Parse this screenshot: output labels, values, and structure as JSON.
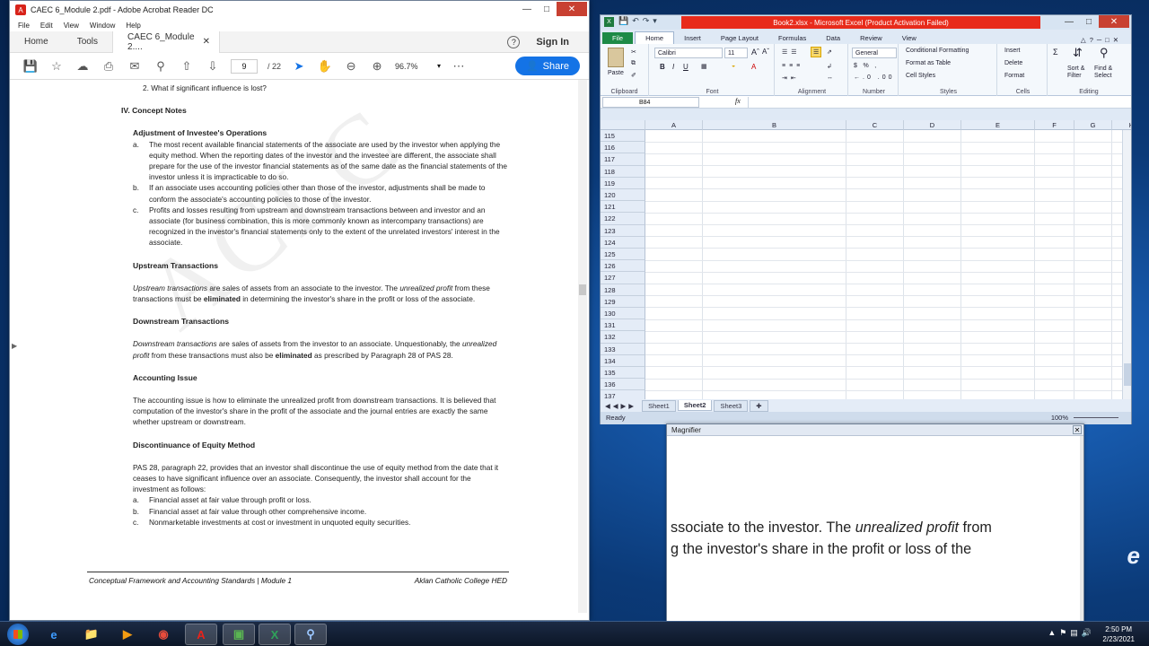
{
  "acrobat": {
    "title": "CAEC 6_Module 2.pdf - Adobe Acrobat Reader DC",
    "menu": [
      "File",
      "Edit",
      "View",
      "Window",
      "Help"
    ],
    "tabs": {
      "home": "Home",
      "tools": "Tools",
      "document": "CAEC 6_Module 2...."
    },
    "signin": "Sign In",
    "help": "?",
    "toolbar": {
      "page_current": "9",
      "page_total": "/ 22",
      "zoom": "96.7%",
      "share": "Share"
    }
  },
  "document": {
    "q2": "2.   What if significant influence is lost?",
    "section": "IV.  Concept Notes",
    "adj_heading": "Adjustment of Investee's Operations",
    "adj_items": [
      {
        "m": "a.",
        "t": "The most recent available financial statements of the associate are used by the investor when applying the equity method. When the reporting dates of the investor and the investee are different, the associate shall prepare for the use of the investor financial statements as of the same date as the financial statements of the investor unless it is impracticable to do so."
      },
      {
        "m": "b.",
        "t": "If an associate uses accounting policies other than those of the investor, adjustments shall be made to conform the associate's accounting policies to those of the investor."
      },
      {
        "m": "c.",
        "t": "Profits and losses resulting from upstream and downstream transactions between and investor and an associate (for business combination, this is more commonly known as intercompany transactions) are recognized in the investor's financial statements only to the extent of the unrelated investors' interest in the associate."
      }
    ],
    "up_heading": "Upstream Transactions",
    "up_a": "Upstream transactions",
    "up_b": " are sales of assets from an associate to the investor. The ",
    "up_c": "unrealized profit",
    "up_d": " from these transactions must be ",
    "up_e": "eliminated",
    "up_f": " in determining the investor's share in the profit or loss of the associate.",
    "down_heading": "Downstream Transactions",
    "down_a": "Downstream transactions",
    "down_b": " are sales of assets from the investor to an associate. Unquestionably, the ",
    "down_c": "unrealized profit",
    "down_d": " from these transactions must also be ",
    "down_e": "eliminated",
    "down_f": " as prescribed by Paragraph 28 of PAS 28.",
    "issue_heading": "Accounting Issue",
    "issue_text": "The accounting issue is how to eliminate the unrealized profit from downstream transactions. It is believed that computation of the investor's share in the profit of the associate and the journal entries are exactly the same whether upstream or downstream.",
    "disc_heading": "Discontinuance of Equity Method",
    "disc_text": "PAS 28, paragraph 22, provides that an investor shall discontinue the use of equity method from the date that it ceases to have significant influence over an associate. Consequently, the investor shall account for the investment as follows:",
    "disc_items": [
      {
        "m": "a.",
        "t": "Financial asset at fair value through profit or loss."
      },
      {
        "m": "b.",
        "t": "Financial asset at fair value through other comprehensive income."
      },
      {
        "m": "c.",
        "t": "Nonmarketable investments at cost or investment in unquoted equity securities."
      }
    ],
    "footer_left": "Conceptual Framework and Accounting Standards | Module 1",
    "footer_right": "Aklan Catholic College HED",
    "watermark": "ACLC"
  },
  "excel": {
    "title": "Book2.xlsx - Microsoft Excel (Product Activation Failed)",
    "tabs": [
      "File",
      "Home",
      "Insert",
      "Page Layout",
      "Formulas",
      "Data",
      "Review",
      "View"
    ],
    "font_name": "Calibri",
    "font_size": "11",
    "number_format": "General",
    "groups": {
      "clipboard": "Clipboard",
      "font": "Font",
      "alignment": "Alignment",
      "number": "Number",
      "styles": "Styles",
      "cells": "Cells",
      "editing": "Editing"
    },
    "paste": "Paste",
    "styles": [
      "Conditional Formatting",
      "Format as Table",
      "Cell Styles"
    ],
    "cells": [
      "Insert",
      "Delete",
      "Format"
    ],
    "editing": [
      "Sort & Filter",
      "Find & Select"
    ],
    "name_box": "B84",
    "fx": "fx",
    "columns": [
      "A",
      "B",
      "C",
      "D",
      "E",
      "F",
      "G",
      "H"
    ],
    "rows": [
      "115",
      "116",
      "117",
      "118",
      "119",
      "120",
      "121",
      "122",
      "123",
      "124",
      "125",
      "126",
      "127",
      "128",
      "129",
      "130",
      "131",
      "132",
      "133",
      "134",
      "135",
      "136",
      "137"
    ],
    "sheets": [
      "Sheet1",
      "Sheet2",
      "Sheet3"
    ],
    "active_sheet": "Sheet2",
    "status": "Ready",
    "zoom": "100%"
  },
  "magnifier": {
    "title": "Magnifier",
    "line1_a": "ssociate to the investor. The ",
    "line1_b": "unrealized profit",
    "line1_c": " from",
    "line2": "g the investor's share in the profit or loss of the"
  },
  "taskbar": {
    "time": "2:50 PM",
    "date": "2/23/2021"
  },
  "desktop_label": "e"
}
